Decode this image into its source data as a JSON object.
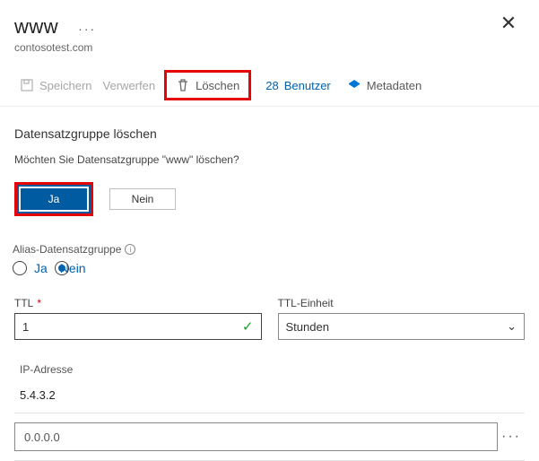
{
  "header": {
    "title": "www",
    "subtitle": "contosotest.com"
  },
  "toolbar": {
    "save": "Speichern",
    "discard": "Verwerfen",
    "delete": "Löschen",
    "users": {
      "count": "28",
      "label": "Benutzer"
    },
    "metadata": "Metadaten"
  },
  "confirm": {
    "title": "Datensatzgruppe löschen",
    "text": "Möchten Sie Datensatzgruppe \"www\" löschen?",
    "yes": "Ja",
    "no": "Nein"
  },
  "alias": {
    "label": "Alias-Datensatzgruppe",
    "yes": "Ja",
    "no": "Nein"
  },
  "ttl": {
    "label": "TTL",
    "value": "1",
    "unit_label": "TTL-Einheit",
    "unit_value": "Stunden"
  },
  "ip": {
    "label": "IP-Adresse",
    "rows": [
      "5.4.3.2"
    ],
    "placeholder": "0.0.0.0"
  }
}
